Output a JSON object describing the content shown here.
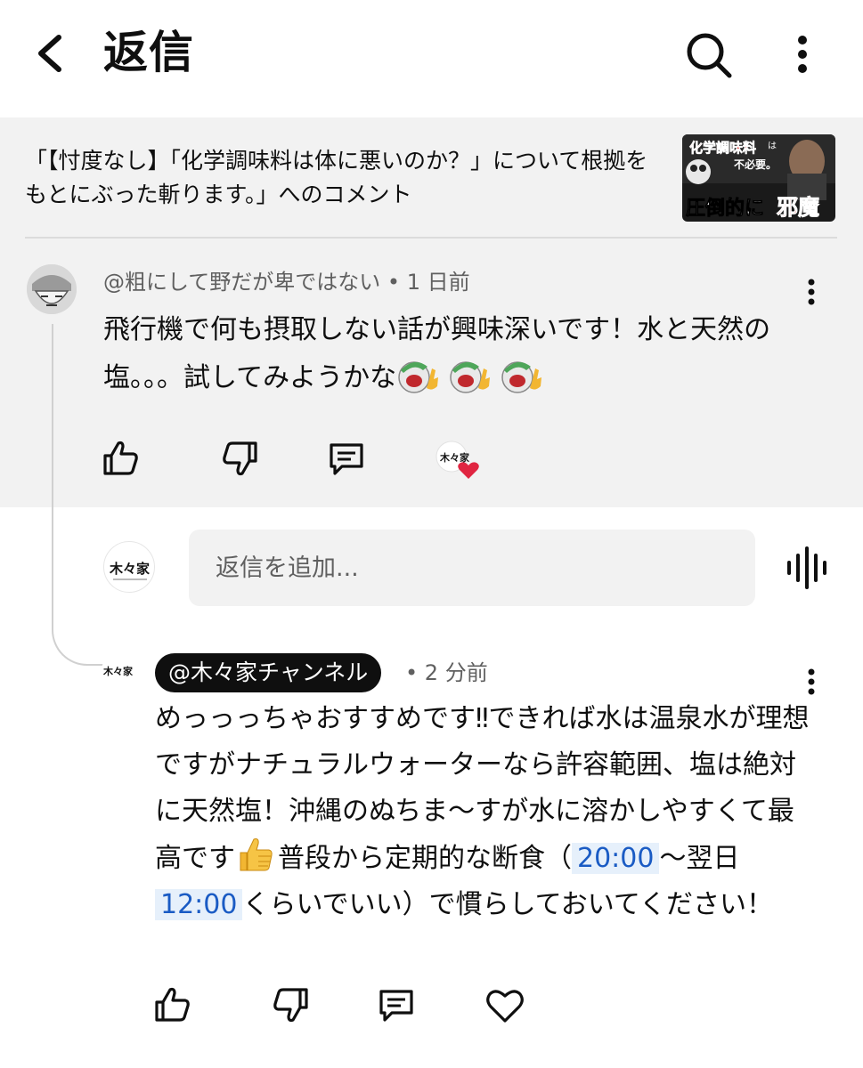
{
  "header": {
    "title": "返信"
  },
  "video": {
    "title": "「【忖度なし】「化学調味料は体に悪いのか？」について根拠をもとにぶった斬ります。」へのコメント",
    "thumbnail_text_top": "化学調味料",
    "thumbnail_text_small1": "は",
    "thumbnail_text_small2": "不必要。",
    "thumbnail_text_bottom": "圧倒的に",
    "thumbnail_text_red": "邪魔"
  },
  "comment": {
    "author": "@粗にして野だが卑ではない",
    "time": "1 日前",
    "text": "飛行機で何も摂取しない話が興味深いです！水と天然の塩。。。試してみようかな"
  },
  "reply_box": {
    "avatar_text": "木々家",
    "placeholder": "返信を追加..."
  },
  "reply": {
    "author": "@木々家チャンネル",
    "time": "2 分前",
    "avatar_text": "木々家",
    "text_part1": "めっっっちゃおすすめです‼︎できれば水は温泉水が理想ですがナチュラルウォーターなら許容範囲、塩は絶対に天然塩！沖縄のぬちま〜すが水に溶かしやすくて最高です",
    "text_part2": "普段から定期的な断食（",
    "timestamp1": "20:00",
    "text_part3": "〜翌日",
    "timestamp2": "12:00",
    "text_part4": "くらいでいい）で慣らしておいてください！"
  },
  "colors": {
    "grey_section": "#f2f2f2",
    "timestamp_bg": "#e6f0fb",
    "timestamp_text": "#1a5bc4",
    "heart": "#e02541"
  },
  "icons": [
    "back-arrow-icon",
    "search-icon",
    "more-vert-icon",
    "like-icon",
    "dislike-icon",
    "reply-icon",
    "heart-icon",
    "voice-search-icon"
  ]
}
